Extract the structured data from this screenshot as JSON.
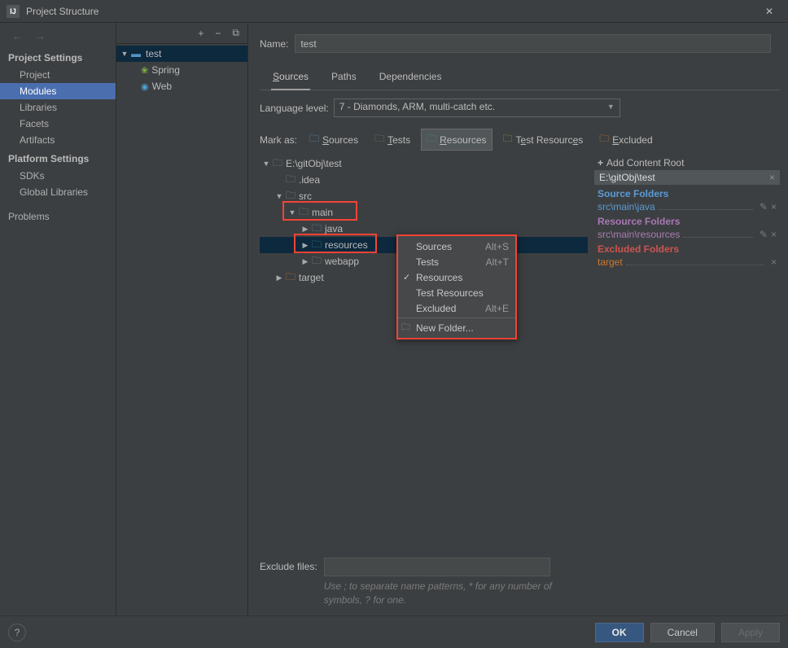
{
  "window": {
    "title": "Project Structure",
    "close_glyph": "✕"
  },
  "nav": {
    "arrows": {
      "back": "←",
      "forward": "→"
    },
    "project_settings_header": "Project Settings",
    "project_settings": [
      "Project",
      "Modules",
      "Libraries",
      "Facets",
      "Artifacts"
    ],
    "platform_settings_header": "Platform Settings",
    "platform_settings": [
      "SDKs",
      "Global Libraries"
    ],
    "problems": "Problems"
  },
  "mid": {
    "toolbar": {
      "add": "+",
      "remove": "−",
      "copy_glyph": "⧉"
    },
    "module": "test",
    "facets": [
      "Spring",
      "Web"
    ]
  },
  "right": {
    "name_label": "Name:",
    "name_value": "test",
    "tabs": [
      "Sources",
      "Paths",
      "Dependencies"
    ],
    "lang_label": "Language level:",
    "lang_value": "7 - Diamonds, ARM, multi-catch etc.",
    "markas_label": "Mark as:",
    "mark_buttons": [
      {
        "label": "Sources",
        "u": "S",
        "color": "c-blue"
      },
      {
        "label": "Tests",
        "u": "T",
        "color": "c-green"
      },
      {
        "label": "Resources",
        "u": "R",
        "color": "c-teal",
        "active": true
      },
      {
        "label": "Test Resources",
        "u": "",
        "color": "c-ty"
      },
      {
        "label": "Excluded",
        "u": "E",
        "color": "c-orange"
      }
    ],
    "src_tree": {
      "root": "E:\\gitObj\\test",
      "idea": ".idea",
      "src": "src",
      "main": "main",
      "java": "java",
      "resources": "resources",
      "webapp": "webapp",
      "target": "target"
    },
    "context_menu": {
      "items": [
        {
          "label": "Sources",
          "shortcut": "Alt+S"
        },
        {
          "label": "Tests",
          "shortcut": "Alt+T"
        },
        {
          "label": "Resources",
          "checked": true
        },
        {
          "label": "Test Resources"
        },
        {
          "label": "Excluded",
          "shortcut": "Alt+E"
        }
      ],
      "new_folder": "New Folder..."
    },
    "sidebar": {
      "add_content_root": "Add Content Root",
      "root_path": "E:\\gitObj\\test",
      "source_folders_title": "Source Folders",
      "source_folder": "src\\main\\java",
      "resource_folders_title": "Resource Folders",
      "resource_folder": "src\\main\\resources",
      "excluded_folders_title": "Excluded Folders",
      "excluded_folder": "target"
    },
    "exclude_label": "Exclude files:",
    "exclude_hint": "Use ; to separate name patterns, * for any number of symbols, ? for one."
  },
  "footer": {
    "help": "?",
    "ok": "OK",
    "cancel": "Cancel",
    "apply": "Apply"
  }
}
